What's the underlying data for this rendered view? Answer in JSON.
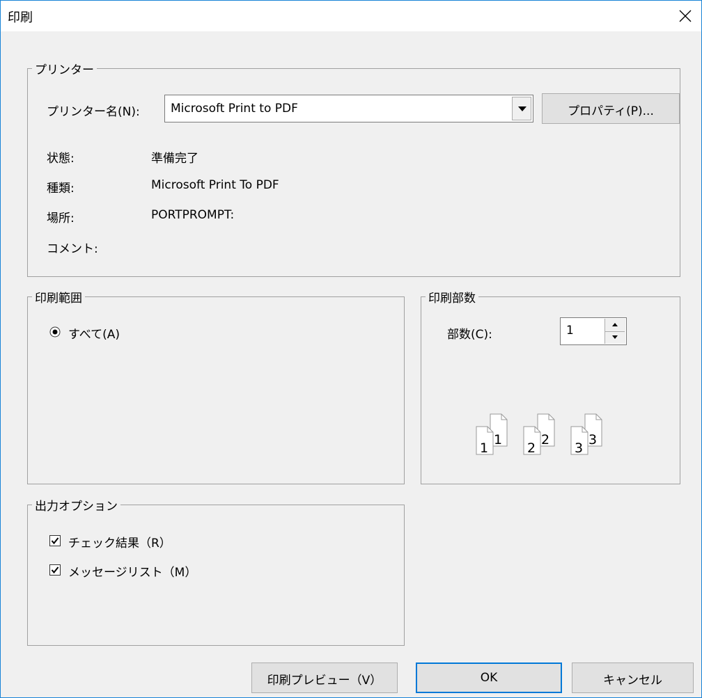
{
  "window": {
    "title": "印刷"
  },
  "printer": {
    "group_label": "プリンター",
    "name_label": "プリンター名(N):",
    "name_value": "Microsoft Print to PDF",
    "properties_button": "プロパティ(P)...",
    "status_label": "状態:",
    "status_value": "準備完了",
    "type_label": "種類:",
    "type_value": "Microsoft Print To PDF",
    "location_label": "場所:",
    "location_value": "PORTPROMPT:",
    "comment_label": "コメント:"
  },
  "print_range": {
    "group_label": "印刷範囲",
    "all_label": "すべて(A)",
    "all_selected": true
  },
  "copies": {
    "group_label": "印刷部数",
    "count_label": "部数(C):",
    "count_value": "1",
    "collate_pages": [
      "1",
      "1",
      "2",
      "2",
      "3",
      "3"
    ]
  },
  "output_options": {
    "group_label": "出力オプション",
    "check_result_label": "チェック結果（R）",
    "check_result_checked": true,
    "message_list_label": "メッセージリスト（M）",
    "message_list_checked": true
  },
  "buttons": {
    "preview": "印刷プレビュー（V）",
    "ok": "OK",
    "cancel": "キャンセル"
  }
}
